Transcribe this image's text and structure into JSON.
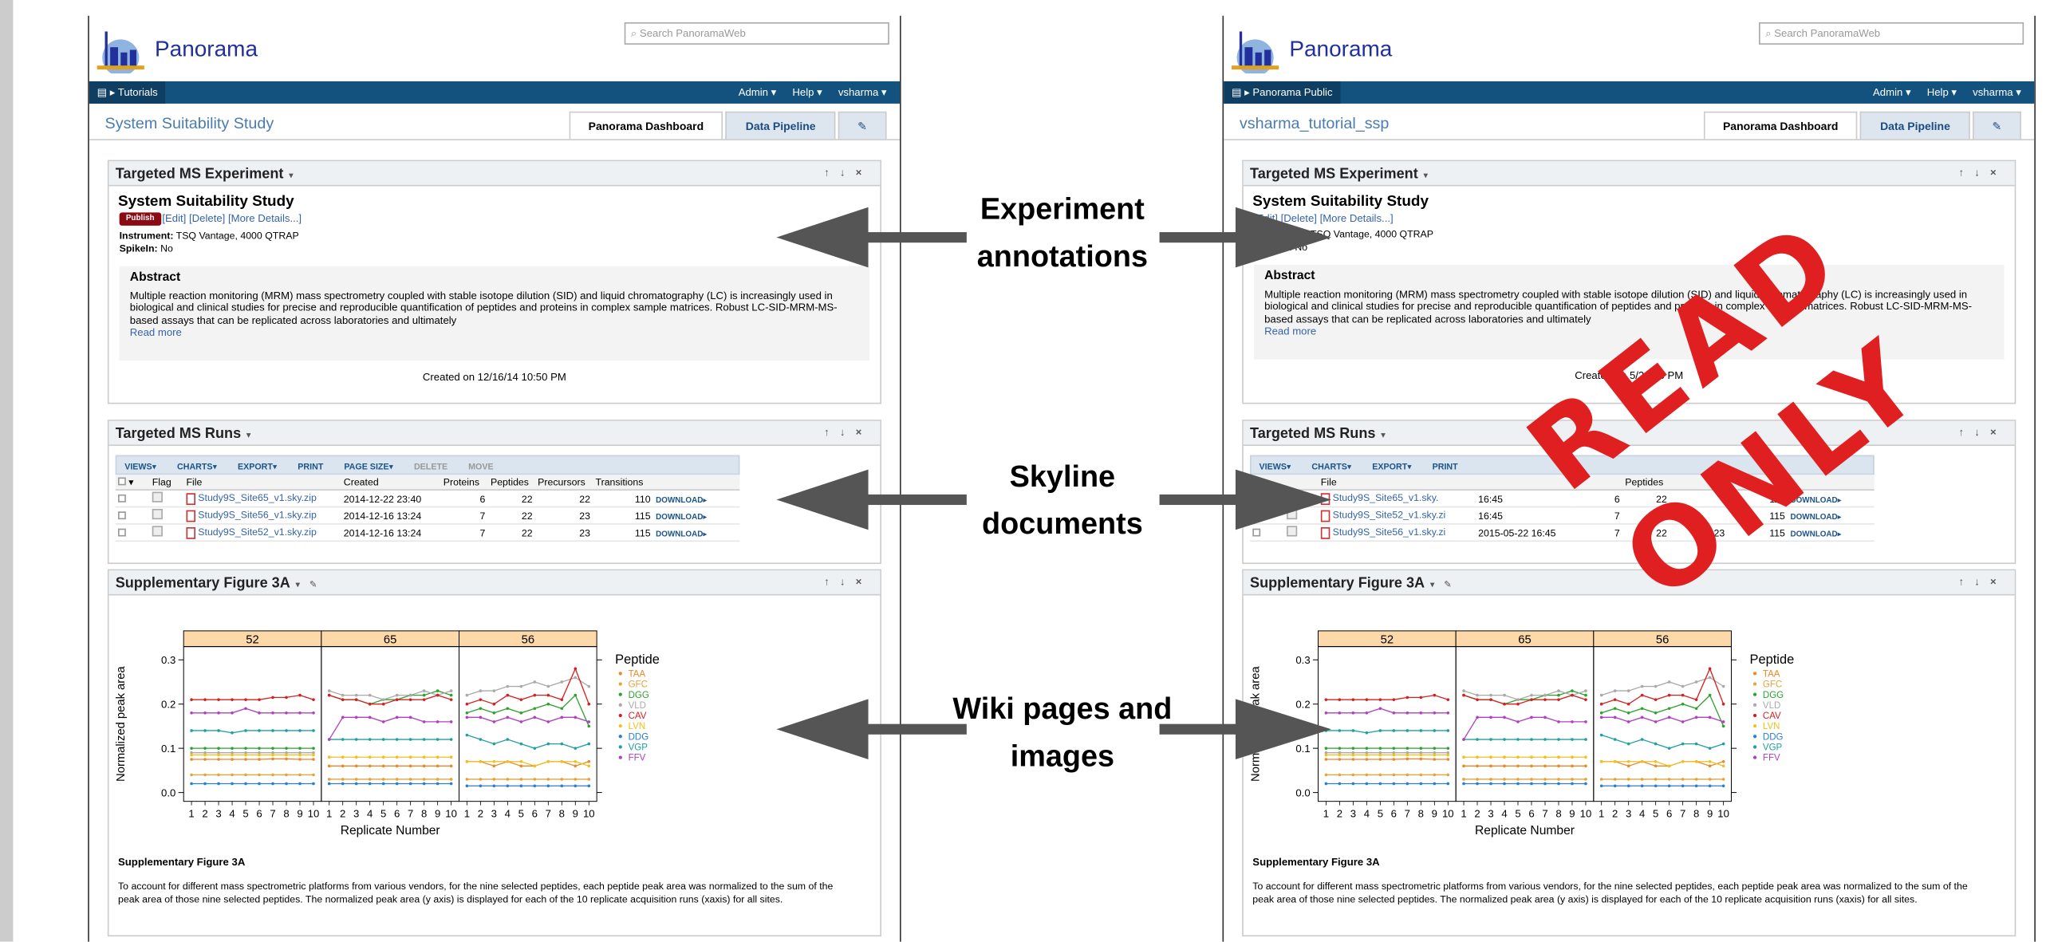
{
  "search_placeholder": "Search PanoramaWeb",
  "logo_text": "Panorama",
  "nav": {
    "admin": "Admin ▾",
    "help": "Help ▾",
    "user": "vsharma ▾"
  },
  "tabs": {
    "dashboard": "Panorama Dashboard",
    "pipeline": "Data Pipeline"
  },
  "left": {
    "crumb": "Tutorials",
    "project": "System Suitability Study",
    "created": "Created on 12/16/14 10:50 PM",
    "runs": [
      {
        "file": "Study9S_Site65_v1.sky.zip",
        "created": "2014-12-22 23:40",
        "proteins": "6",
        "peptides": "22",
        "precursors": "22",
        "transitions": "110"
      },
      {
        "file": "Study9S_Site56_v1.sky.zip",
        "created": "2014-12-16 13:24",
        "proteins": "7",
        "peptides": "22",
        "precursors": "23",
        "transitions": "115"
      },
      {
        "file": "Study9S_Site52_v1.sky.zip",
        "created": "2014-12-16 13:24",
        "proteins": "7",
        "peptides": "22",
        "precursors": "23",
        "transitions": "115"
      }
    ]
  },
  "right": {
    "crumb": "Panorama Public",
    "project": "vsharma_tutorial_ssp",
    "created": "Created on 5/22/15 PM",
    "runs": [
      {
        "file": "Study9S_Site65_v1.sky.",
        "created": "16:45",
        "proteins": "6",
        "peptides": "22",
        "precursors": "",
        "transitions": "110"
      },
      {
        "file": "Study9S_Site52_v1.sky.zi",
        "created": "16:45",
        "proteins": "7",
        "peptides": "",
        "precursors": "",
        "transitions": "115"
      },
      {
        "file": "Study9S_Site56_v1.sky.zi",
        "created": "2015-05-22 16:45",
        "proteins": "7",
        "peptides": "22",
        "precursors": "23",
        "transitions": "115"
      }
    ]
  },
  "experiment": {
    "panel_title": "Targeted MS Experiment",
    "title": "System Suitability Study",
    "publish": "Publish",
    "links": "[Edit] [Delete] [More Details...]",
    "instrument_label": "Instrument:",
    "instrument": "TSQ Vantage, 4000 QTRAP",
    "spikein_label": "SpikeIn:",
    "spikein": "No",
    "abstract_title": "Abstract",
    "abstract": "Multiple reaction monitoring (MRM) mass spectrometry coupled with stable isotope dilution (SID) and liquid chromatography (LC) is increasingly used in biological and clinical studies for precise and reproducible quantification of peptides and proteins in complex sample matrices. Robust LC-SID-MRM-MS-based assays that can be replicated across laboratories and ultimately",
    "read_more": "Read more"
  },
  "runs_panel": {
    "title": "Targeted MS Runs",
    "toolbar": [
      "VIEWS▾",
      "CHARTS▾",
      "EXPORT▾",
      "PRINT",
      "PAGE SIZE▾",
      "DELETE",
      "MOVE"
    ],
    "columns": [
      "Flag",
      "File",
      "Created",
      "Proteins",
      "Peptides",
      "Precursors",
      "Transitions"
    ],
    "download": "DOWNLOAD▸"
  },
  "figure_panel": {
    "title": "Supplementary Figure 3A",
    "caption_title": "Supplementary Figure 3A",
    "caption": "To account for different mass spectrometric platforms from various vendors, for the nine selected peptides, each peptide peak area was normalized to the sum of the peak area of those nine selected peptides. The normalized peak area (y axis) is displayed for each of the 10 replicate acquisition runs (xaxis) for all sites."
  },
  "labels": {
    "experiment": "Experiment annotations",
    "skyline": "Skyline documents",
    "wiki": "Wiki pages and images"
  },
  "stamp": {
    "line1": "READ",
    "line2": "ONLY"
  },
  "chart_data": {
    "type": "line",
    "panels": [
      "52",
      "65",
      "56"
    ],
    "xlabel": "Replicate Number",
    "ylabel": "Normalized peak area",
    "x": [
      1,
      2,
      3,
      4,
      5,
      6,
      7,
      8,
      9,
      10
    ],
    "ylim": [
      -0.02,
      0.33
    ],
    "yticks": [
      0.0,
      0.1,
      0.2,
      0.3
    ],
    "legend_title": "Peptide",
    "series": [
      {
        "name": "TAA",
        "color": "#e8892a",
        "values": [
          [
            0.075,
            0.075,
            0.075,
            0.075,
            0.075,
            0.075,
            0.076,
            0.076,
            0.075,
            0.075
          ],
          [
            0.06,
            0.06,
            0.06,
            0.06,
            0.06,
            0.06,
            0.06,
            0.06,
            0.06,
            0.06
          ],
          [
            0.07,
            0.07,
            0.06,
            0.07,
            0.06,
            0.06,
            0.07,
            0.07,
            0.06,
            0.07
          ]
        ]
      },
      {
        "name": "GFC",
        "color": "#e5a43b",
        "values": [
          [
            0.04,
            0.04,
            0.04,
            0.04,
            0.04,
            0.04,
            0.04,
            0.04,
            0.04,
            0.04
          ],
          [
            0.03,
            0.03,
            0.03,
            0.03,
            0.03,
            0.03,
            0.03,
            0.03,
            0.03,
            0.03
          ],
          [
            0.03,
            0.03,
            0.03,
            0.03,
            0.03,
            0.03,
            0.03,
            0.03,
            0.03,
            0.03
          ]
        ]
      },
      {
        "name": "DGG",
        "color": "#2ea12e",
        "values": [
          [
            0.1,
            0.1,
            0.1,
            0.1,
            0.1,
            0.1,
            0.1,
            0.1,
            0.1,
            0.1
          ],
          [
            0.22,
            0.21,
            0.21,
            0.2,
            0.21,
            0.21,
            0.22,
            0.22,
            0.23,
            0.22
          ],
          [
            0.18,
            0.19,
            0.18,
            0.19,
            0.18,
            0.19,
            0.2,
            0.19,
            0.22,
            0.15
          ]
        ]
      },
      {
        "name": "VLD",
        "color": "#aaaaaa",
        "values": [
          [
            0.09,
            0.09,
            0.09,
            0.09,
            0.09,
            0.09,
            0.09,
            0.09,
            0.09,
            0.09
          ],
          [
            0.23,
            0.22,
            0.22,
            0.22,
            0.21,
            0.22,
            0.22,
            0.23,
            0.22,
            0.23
          ],
          [
            0.22,
            0.23,
            0.23,
            0.24,
            0.24,
            0.25,
            0.24,
            0.25,
            0.26,
            0.24
          ]
        ]
      },
      {
        "name": "CAV",
        "color": "#d62020",
        "values": [
          [
            0.21,
            0.21,
            0.21,
            0.21,
            0.21,
            0.21,
            0.215,
            0.215,
            0.22,
            0.21
          ],
          [
            0.22,
            0.21,
            0.21,
            0.2,
            0.2,
            0.21,
            0.21,
            0.21,
            0.22,
            0.21
          ],
          [
            0.2,
            0.21,
            0.2,
            0.22,
            0.21,
            0.22,
            0.22,
            0.21,
            0.28,
            0.2
          ]
        ]
      },
      {
        "name": "LVN",
        "color": "#f0c020",
        "values": [
          [
            0.085,
            0.085,
            0.085,
            0.085,
            0.085,
            0.085,
            0.085,
            0.085,
            0.085,
            0.085
          ],
          [
            0.08,
            0.08,
            0.08,
            0.08,
            0.08,
            0.08,
            0.08,
            0.08,
            0.08,
            0.08
          ],
          [
            0.07,
            0.07,
            0.07,
            0.07,
            0.07,
            0.06,
            0.07,
            0.07,
            0.07,
            0.06
          ]
        ]
      },
      {
        "name": "DDG",
        "color": "#2a7fd0",
        "values": [
          [
            0.02,
            0.02,
            0.02,
            0.02,
            0.02,
            0.02,
            0.02,
            0.02,
            0.02,
            0.02
          ],
          [
            0.02,
            0.02,
            0.02,
            0.02,
            0.02,
            0.02,
            0.02,
            0.02,
            0.02,
            0.02
          ],
          [
            0.015,
            0.015,
            0.015,
            0.015,
            0.015,
            0.015,
            0.015,
            0.015,
            0.015,
            0.015
          ]
        ]
      },
      {
        "name": "VGP",
        "color": "#20a0a0",
        "values": [
          [
            0.14,
            0.14,
            0.14,
            0.135,
            0.14,
            0.14,
            0.14,
            0.14,
            0.14,
            0.14
          ],
          [
            0.12,
            0.12,
            0.12,
            0.12,
            0.12,
            0.12,
            0.12,
            0.12,
            0.12,
            0.12
          ],
          [
            0.13,
            0.12,
            0.11,
            0.12,
            0.11,
            0.1,
            0.11,
            0.11,
            0.1,
            0.11
          ]
        ]
      },
      {
        "name": "FFV",
        "color": "#b040c0",
        "values": [
          [
            0.18,
            0.18,
            0.18,
            0.18,
            0.19,
            0.18,
            0.18,
            0.18,
            0.18,
            0.18
          ],
          [
            0.12,
            0.17,
            0.17,
            0.17,
            0.16,
            0.17,
            0.17,
            0.16,
            0.16,
            0.16
          ],
          [
            0.17,
            0.17,
            0.16,
            0.17,
            0.16,
            0.17,
            0.16,
            0.17,
            0.17,
            0.16
          ]
        ]
      }
    ]
  }
}
